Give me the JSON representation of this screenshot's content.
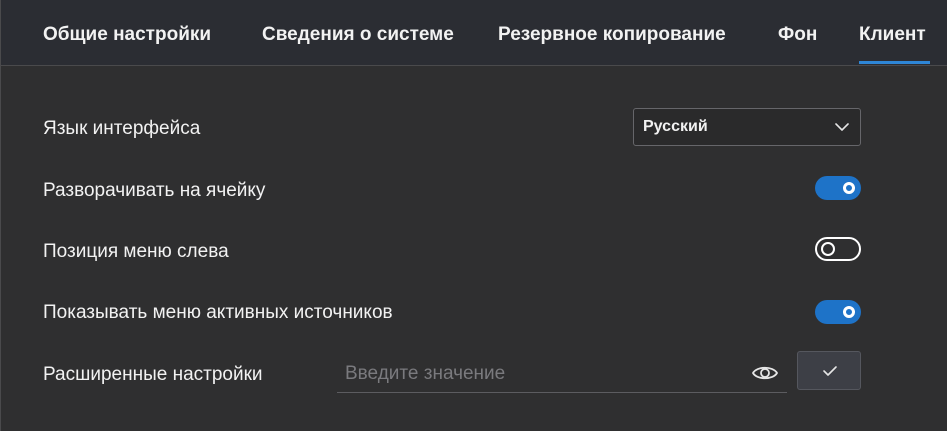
{
  "tabs": [
    {
      "label": "Общие настройки",
      "active": false
    },
    {
      "label": "Сведения о системе",
      "active": false
    },
    {
      "label": "Резервное копирование",
      "active": false
    },
    {
      "label": "Фон",
      "active": false
    },
    {
      "label": "Клиент",
      "active": true
    }
  ],
  "colors": {
    "accent": "#1e73c8",
    "background": "#2f2f30",
    "tabbar": "#2b2d33",
    "text": "#f2f2f2"
  },
  "settings": {
    "language": {
      "label": "Язык интерфейса",
      "value": "Русский",
      "icon": "chevron-down-icon"
    },
    "expand_to_cell": {
      "label": "Разворачивать на ячейку",
      "enabled": true
    },
    "menu_left": {
      "label": "Позиция меню слева",
      "enabled": false
    },
    "show_active_sources": {
      "label": "Показывать меню активных источников",
      "enabled": true
    },
    "advanced": {
      "label": "Расширенные настройки",
      "value": "",
      "placeholder": "Введите значение",
      "visibility_icon": "eye-icon",
      "confirm_icon": "check-icon"
    }
  }
}
